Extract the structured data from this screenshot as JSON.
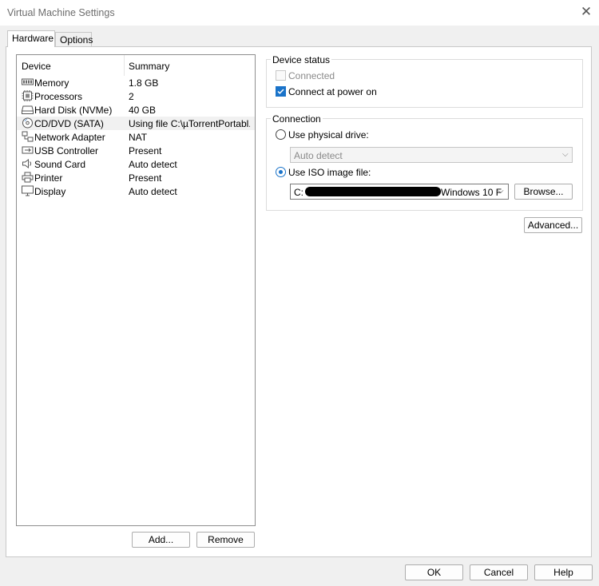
{
  "window": {
    "title": "Virtual Machine Settings"
  },
  "tabs": [
    {
      "label": "Hardware"
    },
    {
      "label": "Options"
    }
  ],
  "device_list": {
    "columns": {
      "device": "Device",
      "summary": "Summary"
    },
    "rows": [
      {
        "name": "Memory",
        "summary": "1.8 GB",
        "icon": "memory-icon"
      },
      {
        "name": "Processors",
        "summary": "2",
        "icon": "processor-icon"
      },
      {
        "name": "Hard Disk (NVMe)",
        "summary": "40 GB",
        "icon": "hard-disk-icon"
      },
      {
        "name": "CD/DVD (SATA)",
        "summary": "Using file C:\\µTorrentPortabl...",
        "icon": "cd-dvd-icon"
      },
      {
        "name": "Network Adapter",
        "summary": "NAT",
        "icon": "network-adapter-icon"
      },
      {
        "name": "USB Controller",
        "summary": "Present",
        "icon": "usb-icon"
      },
      {
        "name": "Sound Card",
        "summary": "Auto detect",
        "icon": "speaker-icon"
      },
      {
        "name": "Printer",
        "summary": "Present",
        "icon": "printer-icon"
      },
      {
        "name": "Display",
        "summary": "Auto detect",
        "icon": "monitor-icon"
      }
    ],
    "add_label": "Add...",
    "remove_label": "Remove"
  },
  "device_status": {
    "title": "Device status",
    "connected": {
      "label": "Connected",
      "checked": false,
      "enabled": false
    },
    "connect_at_power_on": {
      "label": "Connect at power on",
      "checked": true
    }
  },
  "connection": {
    "title": "Connection",
    "physical_drive": {
      "label": "Use physical drive:",
      "selected": false,
      "value": "Auto detect"
    },
    "iso_file": {
      "label": "Use ISO image file:",
      "selected": true,
      "value_start": "C:",
      "value_end": "Windows 10 F",
      "browse_label": "Browse..."
    },
    "advanced_label": "Advanced..."
  },
  "footer": {
    "ok": "OK",
    "cancel": "Cancel",
    "help": "Help"
  },
  "colors": {
    "accent": "#1a73c9",
    "selected_row": "#f1f1f1"
  }
}
